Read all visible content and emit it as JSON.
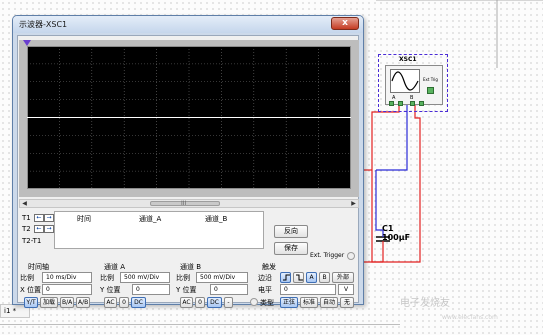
{
  "window": {
    "title": "示波器-XSC1",
    "close_glyph": "x"
  },
  "readout": {
    "t1": "T1",
    "t2": "T2",
    "t2_t1": "T2-T1",
    "col_time": "时间",
    "col_channel_a": "通道_A",
    "col_channel_b": "通道_B",
    "scroll_grip": "III",
    "arrow_left": "←",
    "arrow_right": "→"
  },
  "buttons": {
    "reverse": "反向",
    "save": "保存"
  },
  "ext_trigger_label": "Ext. Trigger",
  "timebase": {
    "title": "时间轴",
    "scale_label": "比例",
    "scale_value": "10 ms/Div",
    "xpos_label": "X 位置",
    "xpos_value": "0",
    "modes": [
      "Y/T",
      "加载",
      "B/A",
      "A/B"
    ]
  },
  "channel_a": {
    "title": "通道 A",
    "scale_label": "比例",
    "scale_value": "500 mV/Div",
    "ypos_label": "Y 位置",
    "ypos_value": "0",
    "coupling": [
      "AC",
      "0",
      "DC"
    ]
  },
  "channel_b": {
    "title": "通道 B",
    "scale_label": "比例",
    "scale_value": "500 mV/Div",
    "ypos_label": "Y 位置",
    "ypos_value": "0",
    "coupling": [
      "AC",
      "0",
      "DC",
      "-"
    ]
  },
  "trigger": {
    "title": "触发",
    "edge_label": "边沿",
    "level_label": "电平",
    "level_value": "0",
    "level_unit": "V",
    "type_label": "类型",
    "source_buttons": [
      "A",
      "B",
      "外部"
    ],
    "type_buttons": [
      "正弦",
      "标准",
      "自动",
      "无"
    ]
  },
  "schematic": {
    "scope_name": "XSC1",
    "ext_trig_label": "Ext Trig",
    "channel_a_label": "A",
    "channel_b_label": "B",
    "capacitor_name": "C1",
    "capacitor_value": "100µF"
  },
  "status_bar": "i1 *",
  "watermark": "电子发烧友",
  "watermark_sub": "www.elecfans.com",
  "colors": {
    "screen_bg": "#000000",
    "trace": "#ffffff",
    "wire_red": "#e32020",
    "wire_blue": "#2a2ad8",
    "selection": "#4a2bd6"
  }
}
